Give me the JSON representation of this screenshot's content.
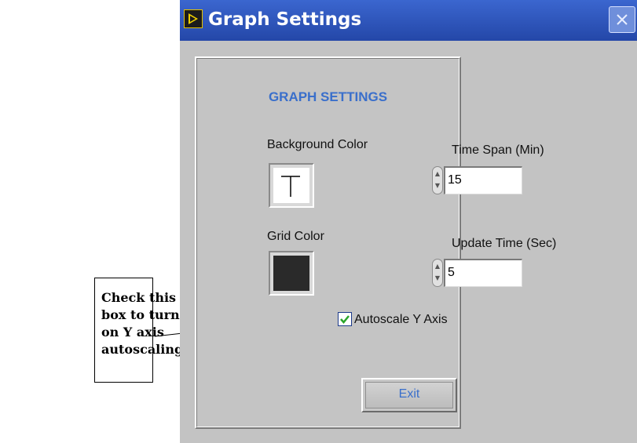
{
  "window": {
    "title": "Graph Settings"
  },
  "panel": {
    "heading": "GRAPH SETTINGS",
    "background_color_label": "Background Color",
    "grid_color_label": "Grid Color",
    "time_span_label": "Time Span (Min)",
    "time_span_value": "15",
    "update_time_label": "Update Time (Sec)",
    "update_time_value": "5",
    "autoscale_label": "Autoscale Y Axis",
    "autoscale_checked": true,
    "exit_label": "Exit"
  },
  "colors": {
    "background_swatch": "#ffffff",
    "grid_swatch": "#2a2a2a",
    "heading_color": "#3a6fcb",
    "titlebar": "#2d55b8"
  },
  "annotation": {
    "text": "Check this\nbox to turn\non Y axis\nautoscaling"
  },
  "icons": {
    "app": "labview-run-icon",
    "close": "close-icon",
    "checkmark": "check-icon"
  }
}
